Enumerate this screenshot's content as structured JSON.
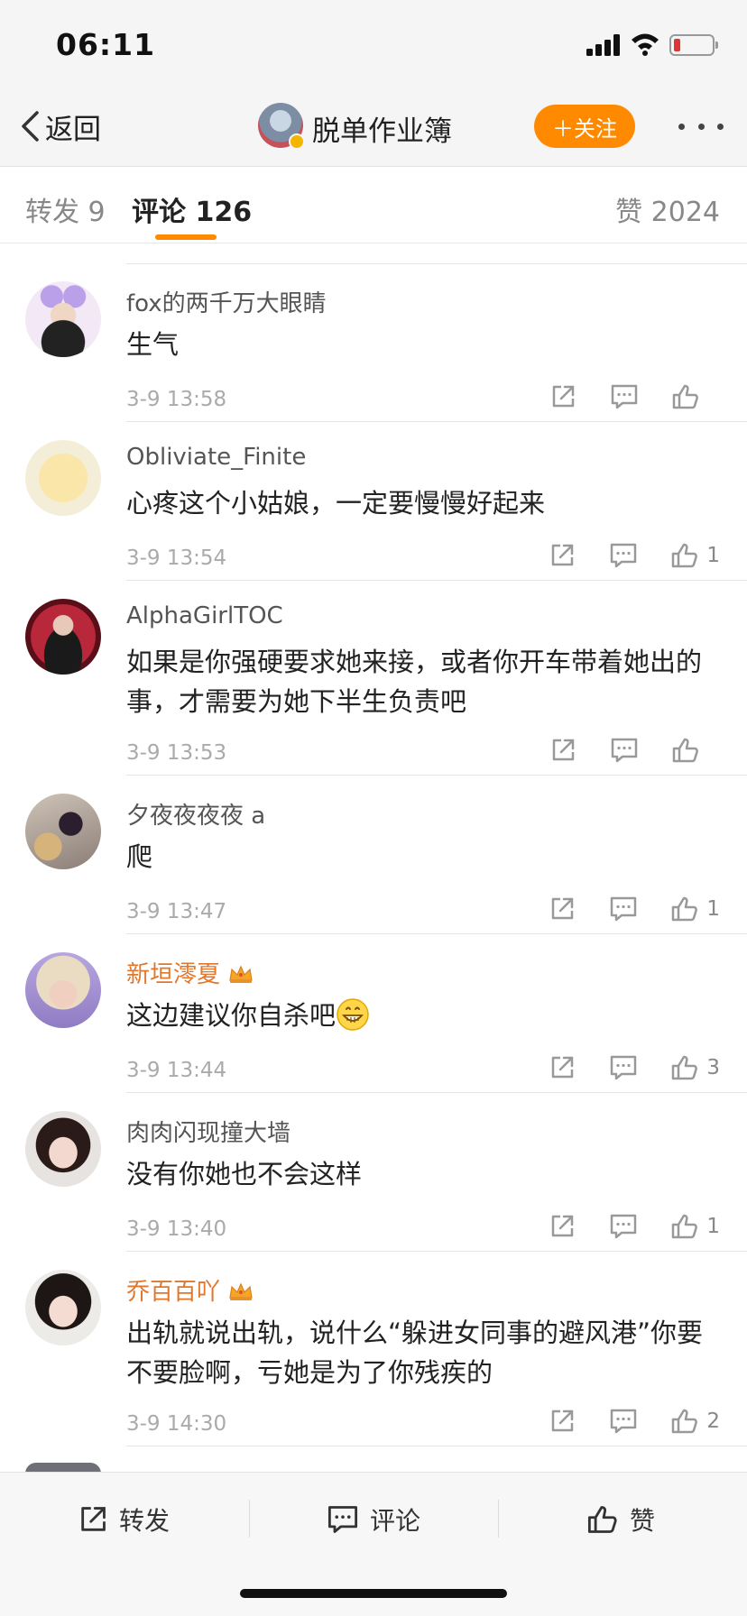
{
  "status_bar": {
    "time": "06:11"
  },
  "nav": {
    "back_label": "返回",
    "title": "脱单作业簿",
    "follow_label": "＋关注"
  },
  "tabs": [
    {
      "label": "转发 9"
    },
    {
      "label": "评论 126"
    },
    {
      "label": "赞 2024"
    }
  ],
  "comments": [
    {
      "name": "fox的两千万大眼睛",
      "text": "生气",
      "time": "3-9 13:58",
      "likes": ""
    },
    {
      "name": "Obliviate_Finite",
      "text": "心疼这个小姑娘，一定要慢慢好起来",
      "time": "3-9 13:54",
      "likes": "1"
    },
    {
      "name": "AlphaGirlTOC",
      "text": "如果是你强硬要求她来接，或者你开车带着她出的事，才需要为她下半生负责吧",
      "time": "3-9 13:53",
      "likes": ""
    },
    {
      "name": "夕夜夜夜夜 a",
      "text": "爬",
      "time": "3-9 13:47",
      "likes": "1"
    },
    {
      "name": "新垣澪夏",
      "text": "这边建议你自杀吧",
      "time": "3-9 13:44",
      "likes": "3"
    },
    {
      "name": "肉肉闪现撞大墙",
      "text": "没有你她也不会这样",
      "time": "3-9 13:40",
      "likes": "1"
    },
    {
      "name": "乔百百吖",
      "text": "出轨就说出轨，说什么“躲进女同事的避风港”你要不要脸啊，亏她是为了你残疾的",
      "time": "3-9 14:30",
      "likes": "2"
    }
  ],
  "bottom_bar": {
    "repost_label": "转发",
    "comment_label": "评论",
    "like_label": "赞"
  },
  "colors": {
    "accent": "#ff8a00",
    "vip_name": "#e2762b"
  }
}
